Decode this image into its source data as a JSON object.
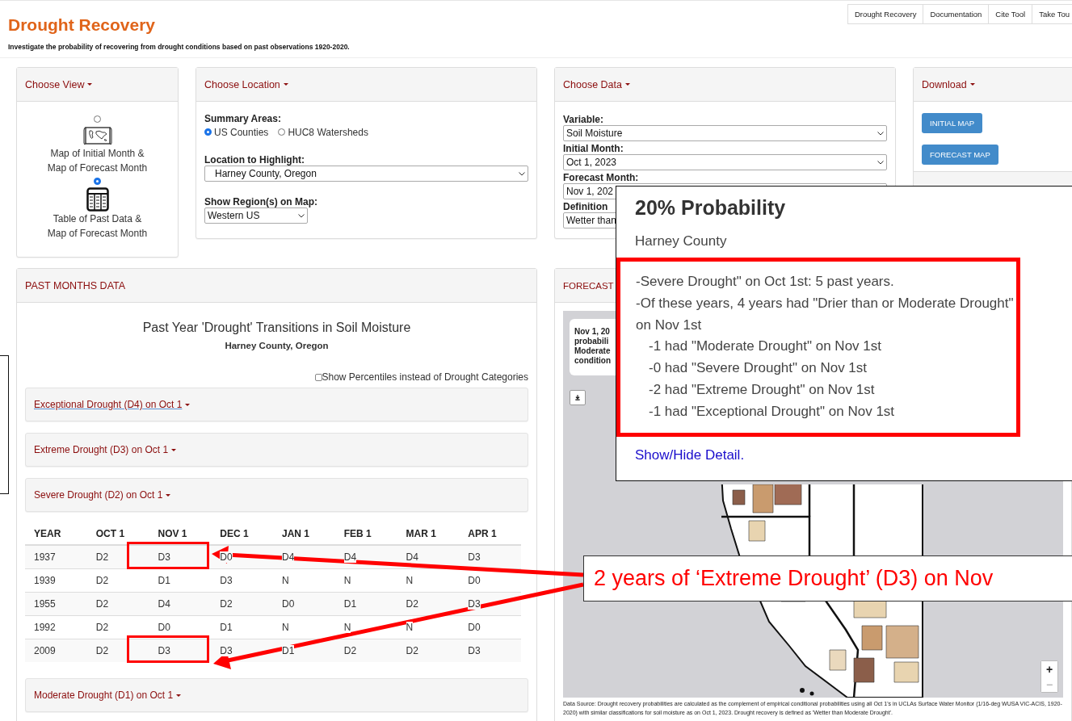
{
  "header": {
    "title": "Drought Recovery",
    "subtitle": "Investigate the probability of recovering from drought conditions based on past observations 1920-2020."
  },
  "nav_tabs": [
    "Drought Recovery",
    "Documentation",
    "Cite Tool",
    "Take Tou"
  ],
  "choose_view": {
    "title": "Choose View",
    "options": [
      {
        "kind": "map",
        "selected": false,
        "lines": [
          "Map of Initial Month &",
          "Map of Forecast Month"
        ]
      },
      {
        "kind": "table",
        "selected": true,
        "lines": [
          "Table of Past Data &",
          "Map of Forecast Month"
        ]
      }
    ]
  },
  "choose_location": {
    "title": "Choose Location",
    "summary_label": "Summary Areas:",
    "summary_options": [
      {
        "label": "US Counties",
        "selected": true
      },
      {
        "label": "HUC8 Watersheds",
        "selected": false
      }
    ],
    "highlight_label": "Location to Highlight:",
    "highlight_value": "Harney County, Oregon",
    "region_label": "Show Region(s) on Map:",
    "region_value": "Western US"
  },
  "choose_data": {
    "title": "Choose Data",
    "fields": [
      {
        "label": "Variable:",
        "value": "Soil Moisture"
      },
      {
        "label": "Initial Month:",
        "value": "Oct 1, 2023"
      },
      {
        "label": "Forecast Month:",
        "value": "Nov 1, 202"
      },
      {
        "label": "Definition",
        "value": "Wetter than"
      }
    ]
  },
  "download": {
    "title": "Download",
    "buttons": [
      "INITIAL MAP",
      "FORECAST MAP"
    ]
  },
  "past_months": {
    "title": "PAST MONTHS DATA",
    "heading": "Past Year 'Drought' Transitions in Soil Moisture",
    "subheading": "Harney County, Oregon",
    "percentile_toggle": {
      "label": "Show Percentiles instead of Drought Categories",
      "checked": false
    },
    "sections": [
      {
        "label": "Exceptional Drought (D4) on Oct 1",
        "hovered": true
      },
      {
        "label": "Extreme Drought (D3) on Oct 1",
        "hovered": false
      },
      {
        "label": "Severe Drought (D2) on Oct 1",
        "hovered": false,
        "table": {
          "columns": [
            "YEAR",
            "OCT 1",
            "NOV 1",
            "DEC 1",
            "JAN 1",
            "FEB 1",
            "MAR 1",
            "APR 1"
          ],
          "rows": [
            [
              {
                "text": "1937",
                "boxed": false
              },
              {
                "text": "D2",
                "boxed": false
              },
              {
                "text": "D3",
                "boxed": true
              },
              {
                "text": "D0",
                "boxed": false
              },
              {
                "text": "D4",
                "boxed": false
              },
              {
                "text": "D4",
                "boxed": false
              },
              {
                "text": "D4",
                "boxed": false
              },
              {
                "text": "D3",
                "boxed": false
              }
            ],
            [
              {
                "text": "1939",
                "boxed": false
              },
              {
                "text": "D2",
                "boxed": false
              },
              {
                "text": "D1",
                "boxed": false
              },
              {
                "text": "D3",
                "boxed": false
              },
              {
                "text": "N",
                "boxed": false
              },
              {
                "text": "N",
                "boxed": false
              },
              {
                "text": "N",
                "boxed": false
              },
              {
                "text": "D0",
                "boxed": false
              }
            ],
            [
              {
                "text": "1955",
                "boxed": false
              },
              {
                "text": "D2",
                "boxed": false
              },
              {
                "text": "D4",
                "boxed": false
              },
              {
                "text": "D2",
                "boxed": false
              },
              {
                "text": "D0",
                "boxed": false
              },
              {
                "text": "D1",
                "boxed": false
              },
              {
                "text": "D2",
                "boxed": false
              },
              {
                "text": "D3",
                "boxed": false
              }
            ],
            [
              {
                "text": "1992",
                "boxed": false
              },
              {
                "text": "D2",
                "boxed": false
              },
              {
                "text": "D0",
                "boxed": false
              },
              {
                "text": "D1",
                "boxed": false
              },
              {
                "text": "N",
                "boxed": false
              },
              {
                "text": "N",
                "boxed": false
              },
              {
                "text": "N",
                "boxed": false
              },
              {
                "text": "D0",
                "boxed": false
              }
            ],
            [
              {
                "text": "2009",
                "boxed": false
              },
              {
                "text": "D2",
                "boxed": false
              },
              {
                "text": "D3",
                "boxed": true
              },
              {
                "text": "D3",
                "boxed": false
              },
              {
                "text": "D1",
                "boxed": false
              },
              {
                "text": "D2",
                "boxed": false
              },
              {
                "text": "D2",
                "boxed": false
              },
              {
                "text": "D3",
                "boxed": false
              }
            ]
          ]
        }
      },
      {
        "label": "Moderate Drought (D1) on Oct 1",
        "hovered": false
      }
    ]
  },
  "forecast": {
    "title": "FORECAST",
    "info_lines": [
      "Nov 1, 20",
      "probabili",
      "Moderate",
      "condition"
    ],
    "map_controls": [
      {
        "label": "+",
        "disabled": false
      },
      {
        "label": "−",
        "disabled": true
      }
    ],
    "data_source": "Data Source: Drought recovery probabilities are calculated as the complement of empirical conditional probabilities using all Oct 1's in UCLAs Surface Water Monitor (1/16-deg WUSA VIC-ACIS, 1920-2020) with similar classifications for soil moisture as on Oct 1, 2023. Drought recovery is defined as 'Wetter than Moderate Drought'."
  },
  "popup": {
    "title": "20% Probability",
    "subtitle": "Harney County",
    "details": [
      {
        "text": "-Severe Drought\" on Oct 1st: 5 past years."
      },
      {
        "text": "-Of these years, 4 years had \"Drier than or Moderate Drought\" on Nov 1st",
        "children": [
          {
            "text": "-1 had \"Moderate Drought\" on Nov 1st"
          },
          {
            "text": "-0 had \"Severe Drought\" on Nov 1st"
          },
          {
            "text": "-2 had \"Extreme Drought\" on Nov 1st"
          },
          {
            "text": "-1 had \"Exceptional Drought\" on Nov 1st"
          }
        ]
      }
    ],
    "link": "Show/Hide Detail."
  },
  "annotation": {
    "text": "2 years of ‘Extreme Drought’ (D3) on Nov"
  }
}
